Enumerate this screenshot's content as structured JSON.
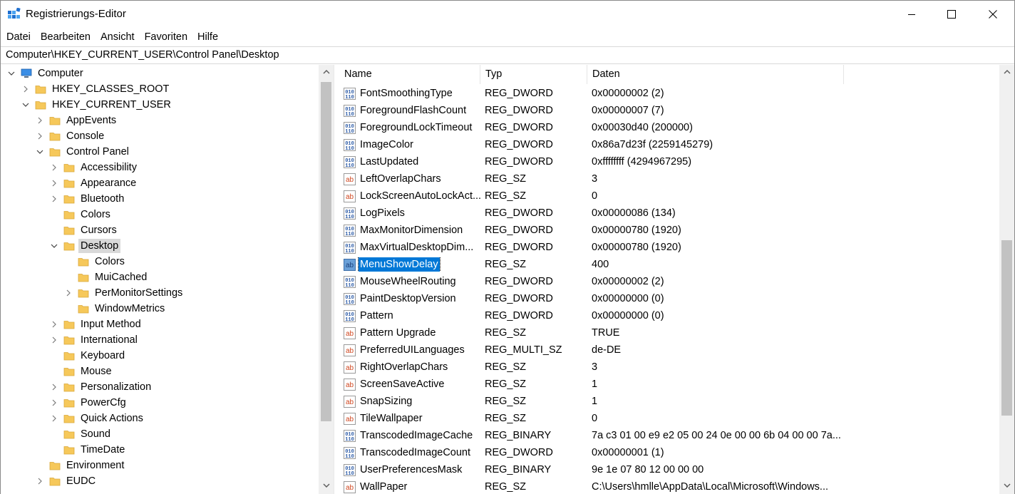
{
  "window": {
    "title": "Registrierungs-Editor"
  },
  "menu": [
    "Datei",
    "Bearbeiten",
    "Ansicht",
    "Favoriten",
    "Hilfe"
  ],
  "address": "Computer\\HKEY_CURRENT_USER\\Control Panel\\Desktop",
  "tree": [
    {
      "label": "Computer",
      "level": 0,
      "expander": "expanded",
      "icon": "computer-icon"
    },
    {
      "label": "HKEY_CLASSES_ROOT",
      "level": 1,
      "expander": "collapsed",
      "icon": "folder-icon"
    },
    {
      "label": "HKEY_CURRENT_USER",
      "level": 1,
      "expander": "expanded",
      "icon": "folder-icon"
    },
    {
      "label": "AppEvents",
      "level": 2,
      "expander": "collapsed",
      "icon": "folder-icon"
    },
    {
      "label": "Console",
      "level": 2,
      "expander": "collapsed",
      "icon": "folder-icon"
    },
    {
      "label": "Control Panel",
      "level": 2,
      "expander": "expanded",
      "icon": "folder-icon"
    },
    {
      "label": "Accessibility",
      "level": 3,
      "expander": "collapsed",
      "icon": "folder-icon"
    },
    {
      "label": "Appearance",
      "level": 3,
      "expander": "collapsed",
      "icon": "folder-icon"
    },
    {
      "label": "Bluetooth",
      "level": 3,
      "expander": "collapsed",
      "icon": "folder-icon"
    },
    {
      "label": "Colors",
      "level": 3,
      "expander": "none",
      "icon": "folder-icon"
    },
    {
      "label": "Cursors",
      "level": 3,
      "expander": "none",
      "icon": "folder-icon"
    },
    {
      "label": "Desktop",
      "level": 3,
      "expander": "expanded",
      "icon": "folder-icon",
      "selected": true
    },
    {
      "label": "Colors",
      "level": 4,
      "expander": "none",
      "icon": "folder-icon"
    },
    {
      "label": "MuiCached",
      "level": 4,
      "expander": "none",
      "icon": "folder-icon"
    },
    {
      "label": "PerMonitorSettings",
      "level": 4,
      "expander": "collapsed",
      "icon": "folder-icon"
    },
    {
      "label": "WindowMetrics",
      "level": 4,
      "expander": "none",
      "icon": "folder-icon"
    },
    {
      "label": "Input Method",
      "level": 3,
      "expander": "collapsed",
      "icon": "folder-icon"
    },
    {
      "label": "International",
      "level": 3,
      "expander": "collapsed",
      "icon": "folder-icon"
    },
    {
      "label": "Keyboard",
      "level": 3,
      "expander": "none",
      "icon": "folder-icon"
    },
    {
      "label": "Mouse",
      "level": 3,
      "expander": "none",
      "icon": "folder-icon"
    },
    {
      "label": "Personalization",
      "level": 3,
      "expander": "collapsed",
      "icon": "folder-icon"
    },
    {
      "label": "PowerCfg",
      "level": 3,
      "expander": "collapsed",
      "icon": "folder-icon"
    },
    {
      "label": "Quick Actions",
      "level": 3,
      "expander": "collapsed",
      "icon": "folder-icon"
    },
    {
      "label": "Sound",
      "level": 3,
      "expander": "none",
      "icon": "folder-icon"
    },
    {
      "label": "TimeDate",
      "level": 3,
      "expander": "none",
      "icon": "folder-icon"
    },
    {
      "label": "Environment",
      "level": 2,
      "expander": "none",
      "icon": "folder-icon"
    },
    {
      "label": "EUDC",
      "level": 2,
      "expander": "collapsed",
      "icon": "folder-icon"
    }
  ],
  "columns": [
    "Name",
    "Typ",
    "Daten"
  ],
  "values": [
    {
      "name": "FontSmoothingType",
      "type": "REG_DWORD",
      "data": "0x00000002 (2)",
      "icon": "binary-value-icon"
    },
    {
      "name": "ForegroundFlashCount",
      "type": "REG_DWORD",
      "data": "0x00000007 (7)",
      "icon": "binary-value-icon"
    },
    {
      "name": "ForegroundLockTimeout",
      "type": "REG_DWORD",
      "data": "0x00030d40 (200000)",
      "icon": "binary-value-icon"
    },
    {
      "name": "ImageColor",
      "type": "REG_DWORD",
      "data": "0x86a7d23f (2259145279)",
      "icon": "binary-value-icon"
    },
    {
      "name": "LastUpdated",
      "type": "REG_DWORD",
      "data": "0xffffffff (4294967295)",
      "icon": "binary-value-icon"
    },
    {
      "name": "LeftOverlapChars",
      "type": "REG_SZ",
      "data": "3",
      "icon": "string-value-icon"
    },
    {
      "name": "LockScreenAutoLockAct...",
      "type": "REG_SZ",
      "data": "0",
      "icon": "string-value-icon"
    },
    {
      "name": "LogPixels",
      "type": "REG_DWORD",
      "data": "0x00000086 (134)",
      "icon": "binary-value-icon"
    },
    {
      "name": "MaxMonitorDimension",
      "type": "REG_DWORD",
      "data": "0x00000780 (1920)",
      "icon": "binary-value-icon"
    },
    {
      "name": "MaxVirtualDesktopDim...",
      "type": "REG_DWORD",
      "data": "0x00000780 (1920)",
      "icon": "binary-value-icon"
    },
    {
      "name": "MenuShowDelay",
      "type": "REG_SZ",
      "data": "400",
      "icon": "string-value-icon",
      "selected": true
    },
    {
      "name": "MouseWheelRouting",
      "type": "REG_DWORD",
      "data": "0x00000002 (2)",
      "icon": "binary-value-icon"
    },
    {
      "name": "PaintDesktopVersion",
      "type": "REG_DWORD",
      "data": "0x00000000 (0)",
      "icon": "binary-value-icon"
    },
    {
      "name": "Pattern",
      "type": "REG_DWORD",
      "data": "0x00000000 (0)",
      "icon": "binary-value-icon"
    },
    {
      "name": "Pattern Upgrade",
      "type": "REG_SZ",
      "data": "TRUE",
      "icon": "string-value-icon"
    },
    {
      "name": "PreferredUILanguages",
      "type": "REG_MULTI_SZ",
      "data": "de-DE",
      "icon": "string-value-icon"
    },
    {
      "name": "RightOverlapChars",
      "type": "REG_SZ",
      "data": "3",
      "icon": "string-value-icon"
    },
    {
      "name": "ScreenSaveActive",
      "type": "REG_SZ",
      "data": "1",
      "icon": "string-value-icon"
    },
    {
      "name": "SnapSizing",
      "type": "REG_SZ",
      "data": "1",
      "icon": "string-value-icon"
    },
    {
      "name": "TileWallpaper",
      "type": "REG_SZ",
      "data": "0",
      "icon": "string-value-icon"
    },
    {
      "name": "TranscodedImageCache",
      "type": "REG_BINARY",
      "data": "7a c3 01 00 e9 e2 05 00 24 0e 00 00 6b 04 00 00 7a...",
      "icon": "binary-value-icon"
    },
    {
      "name": "TranscodedImageCount",
      "type": "REG_DWORD",
      "data": "0x00000001 (1)",
      "icon": "binary-value-icon"
    },
    {
      "name": "UserPreferencesMask",
      "type": "REG_BINARY",
      "data": "9e 1e 07 80 12 00 00 00",
      "icon": "binary-value-icon"
    },
    {
      "name": "WallPaper",
      "type": "REG_SZ",
      "data": "C:\\Users\\hmlle\\AppData\\Local\\Microsoft\\Windows...",
      "icon": "string-value-icon"
    }
  ],
  "colors": {
    "selection": "#0078d7",
    "tree_selection": "#d9d9d9",
    "folder": "#f6c85a",
    "string_icon": "#d0461f",
    "binary_icon": "#2f5da8"
  }
}
